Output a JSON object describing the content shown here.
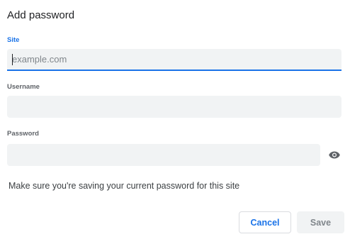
{
  "dialog": {
    "title": "Add password",
    "note": "Make sure you're saving your current password for this site"
  },
  "site": {
    "label": "Site",
    "placeholder": "example.com",
    "value": ""
  },
  "username": {
    "label": "Username",
    "value": ""
  },
  "password": {
    "label": "Password",
    "value": "",
    "toggle_icon": "eye-icon"
  },
  "buttons": {
    "cancel": "Cancel",
    "save": "Save"
  },
  "colors": {
    "accent": "#1a73e8",
    "field_bg": "#f1f3f4",
    "disabled_text": "#80868b"
  }
}
